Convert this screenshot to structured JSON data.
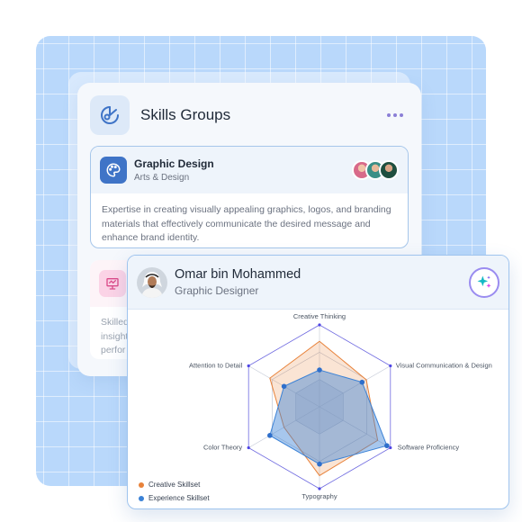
{
  "skills_groups": {
    "title": "Skills Groups",
    "icon": "brain-chart-icon",
    "more_icon": "more-horizontal-icon",
    "groups": [
      {
        "name": "Graphic Design",
        "category": "Arts & Design",
        "icon": "palette-icon",
        "description": "Expertise in creating visually appealing graphics, logos, and branding materials that effectively communicate the desired message and enhance brand identity.",
        "member_avatar_colors": [
          "#d86a8a",
          "#3a8f86",
          "#1f4f3f"
        ]
      },
      {
        "name": "",
        "category": "",
        "icon": "presentation-board-icon",
        "description_visible_lines": [
          "Skilled",
          "insight",
          "perfor"
        ]
      }
    ]
  },
  "profile": {
    "name": "Omar bin Mohammed",
    "role": "Graphic Designer",
    "ai_icon": "sparkles-icon"
  },
  "chart_data": {
    "type": "radar",
    "axes": [
      "Creative Thinking",
      "Visual Communication & Design",
      "Software Proficiency",
      "Typography",
      "Color Theory",
      "Attention to Detail"
    ],
    "range": [
      0,
      100
    ],
    "levels": 3,
    "series": [
      {
        "name": "Creative Skillset",
        "color": "#e8823a",
        "values": [
          80,
          66,
          82,
          84,
          50,
          70
        ]
      },
      {
        "name": "Experience Skillset",
        "color": "#3b82d6",
        "values": [
          45,
          60,
          95,
          70,
          70,
          50
        ]
      }
    ],
    "legend_position": "bottom-left"
  },
  "colors": {
    "accent": "#3f74c7",
    "card_border": "#a6c6ea",
    "background": "#b9d8fb"
  }
}
